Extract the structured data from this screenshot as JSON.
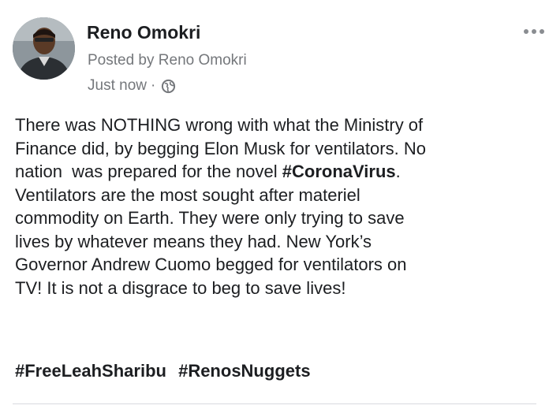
{
  "post": {
    "author": "Reno Omokri",
    "posted_by": "Posted by Reno Omokri",
    "timestamp": "Just now",
    "separator": "·",
    "privacy_icon": "globe-icon",
    "more_icon": "more-options-icon",
    "body_lines": [
      {
        "text": "There was NOTHING wrong with what the Ministry of"
      },
      {
        "text": "Finance did, by begging Elon Musk for ventilators. No"
      },
      {
        "prefix": "nation  was prepared for the novel ",
        "hashtag": "#CoronaVirus",
        "suffix": "."
      },
      {
        "text": "Ventilators are the most sought after materiel"
      },
      {
        "text": "commodity on Earth. They were only trying to save"
      },
      {
        "text": "lives by whatever means they had. New York’s"
      },
      {
        "text": "Governor Andrew Cuomo begged for ventilators on"
      },
      {
        "text": "TV! It is not a disgrace to beg to save lives!"
      }
    ],
    "hashtags": [
      "#FreeLeahSharibu",
      "#RenosNuggets"
    ]
  },
  "colors": {
    "text": "#1c1e21",
    "meta": "#74777b",
    "divider": "#d8dadf"
  }
}
